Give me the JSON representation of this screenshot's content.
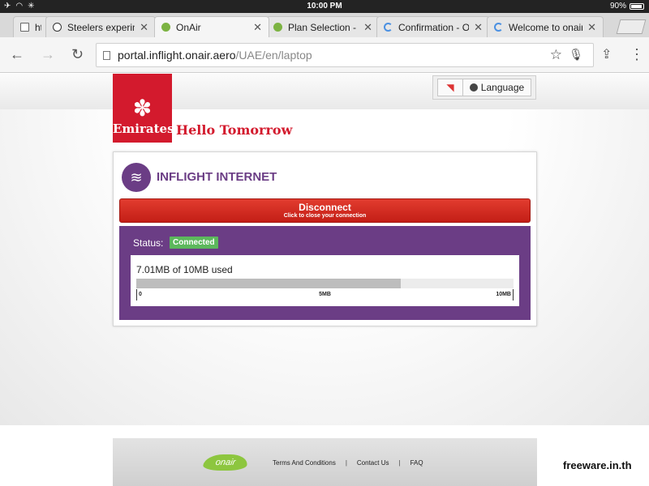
{
  "status_bar": {
    "time": "10:00 PM",
    "battery": "90%"
  },
  "tabs": [
    {
      "title": "htt",
      "icon": "document-icon",
      "close": ""
    },
    {
      "title": "Steelers experime",
      "icon": "steelers-icon",
      "close": "✕"
    },
    {
      "title": "OnAir",
      "icon": "onair-icon",
      "close": "✕",
      "active": true
    },
    {
      "title": "Plan Selection - O",
      "icon": "onair-icon",
      "close": "✕"
    },
    {
      "title": "Confirmation - On",
      "icon": "loading-icon",
      "close": "✕"
    },
    {
      "title": "Welcome to onair",
      "icon": "loading-icon",
      "close": "✕"
    }
  ],
  "address_bar": {
    "host": "portal.inflight.onair.aero",
    "path": "/UAE/en/laptop"
  },
  "brand": {
    "logo_text": "Emirates",
    "tagline": "Hello Tomorrow",
    "color": "#d31a2d"
  },
  "language_button": "Language",
  "card": {
    "title": "INFLIGHT INTERNET",
    "accent": "#6b3d85",
    "disconnect": {
      "label": "Disconnect",
      "sublabel": "Click to close your connection"
    },
    "status_label": "Status:",
    "status_value": "Connected",
    "usage_text": "7.01MB of 10MB used",
    "usage_fraction": 0.701,
    "scale": [
      "0",
      "5MB",
      "10MB"
    ]
  },
  "footer": {
    "logo_text": "onair",
    "links": [
      "Terms And Conditions",
      "Contact Us",
      "FAQ"
    ]
  },
  "watermark": "freeware.in.th"
}
